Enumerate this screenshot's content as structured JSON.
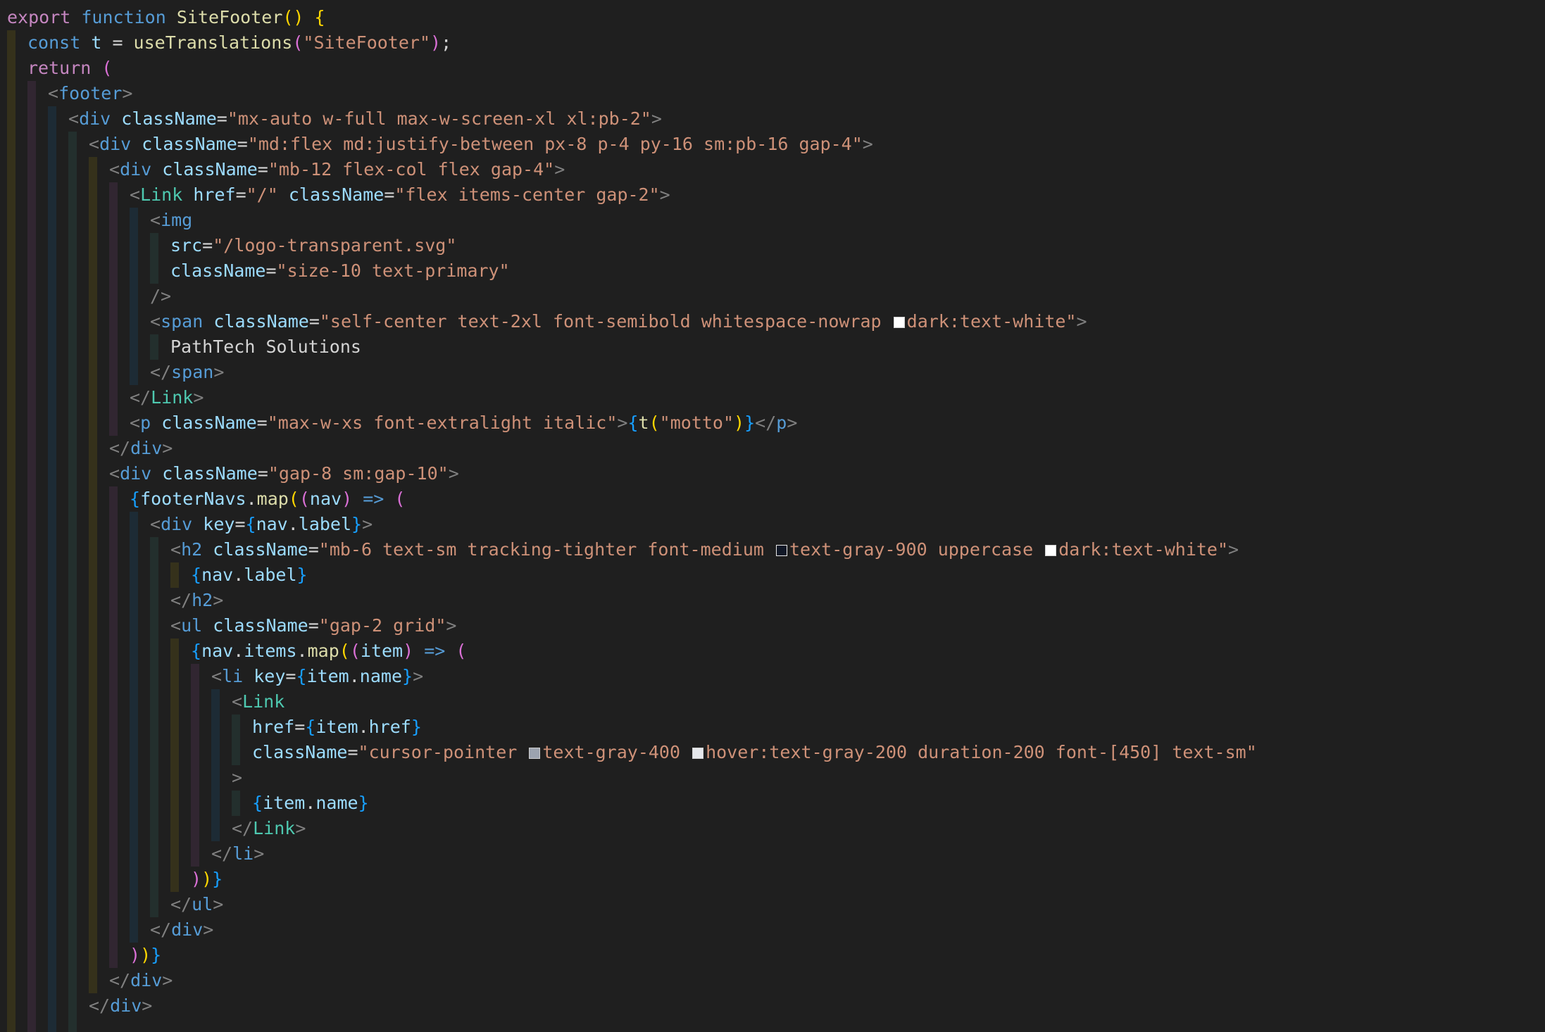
{
  "editor": {
    "colors": {
      "background": "#1f1f1f",
      "keyword": "#c586c0",
      "storage": "#569cd6",
      "function": "#dcdcaa",
      "variable": "#9cdcfe",
      "string": "#ce9178",
      "component_tag": "#4ec9b0",
      "html_tag": "#569cd6",
      "punctuation": "#808080",
      "text": "#d4d4d4",
      "bracket_level_1": "#ffd700",
      "bracket_level_2": "#da70d6",
      "bracket_level_3": "#179fff"
    },
    "lines": [
      {
        "indent": 0,
        "tokens": [
          [
            "kw",
            "export"
          ],
          [
            "tx",
            " "
          ],
          [
            "sk",
            "function"
          ],
          [
            "tx",
            " "
          ],
          [
            "fn",
            "SiteFooter"
          ],
          [
            "b1",
            "()"
          ],
          [
            "tx",
            " "
          ],
          [
            "b1",
            "{"
          ]
        ]
      },
      {
        "indent": 1,
        "tokens": [
          [
            "sk",
            "const"
          ],
          [
            "tx",
            " "
          ],
          [
            "vr",
            "t"
          ],
          [
            "op",
            " = "
          ],
          [
            "fn",
            "useTranslations"
          ],
          [
            "b2",
            "("
          ],
          [
            "st",
            "\"SiteFooter\""
          ],
          [
            "b2",
            ")"
          ],
          [
            "tx",
            ";"
          ]
        ]
      },
      {
        "indent": 1,
        "tokens": [
          [
            "kw",
            "return"
          ],
          [
            "tx",
            " "
          ],
          [
            "b2",
            "("
          ]
        ]
      },
      {
        "indent": 2,
        "tokens": [
          [
            "pu",
            "<"
          ],
          [
            "ht",
            "footer"
          ],
          [
            "pu",
            ">"
          ]
        ]
      },
      {
        "indent": 3,
        "tokens": [
          [
            "pu",
            "<"
          ],
          [
            "ht",
            "div"
          ],
          [
            "tx",
            " "
          ],
          [
            "at",
            "className"
          ],
          [
            "op",
            "="
          ],
          [
            "st",
            "\"mx-auto w-full max-w-screen-xl xl:pb-2\""
          ],
          [
            "pu",
            ">"
          ]
        ]
      },
      {
        "indent": 4,
        "tokens": [
          [
            "pu",
            "<"
          ],
          [
            "ht",
            "div"
          ],
          [
            "tx",
            " "
          ],
          [
            "at",
            "className"
          ],
          [
            "op",
            "="
          ],
          [
            "st",
            "\"md:flex md:justify-between px-8 p-4 py-16 sm:pb-16 gap-4\""
          ],
          [
            "pu",
            ">"
          ]
        ]
      },
      {
        "indent": 5,
        "tokens": [
          [
            "pu",
            "<"
          ],
          [
            "ht",
            "div"
          ],
          [
            "tx",
            " "
          ],
          [
            "at",
            "className"
          ],
          [
            "op",
            "="
          ],
          [
            "st",
            "\"mb-12 flex-col flex gap-4\""
          ],
          [
            "pu",
            ">"
          ]
        ]
      },
      {
        "indent": 6,
        "tokens": [
          [
            "pu",
            "<"
          ],
          [
            "tg",
            "Link"
          ],
          [
            "tx",
            " "
          ],
          [
            "at",
            "href"
          ],
          [
            "op",
            "="
          ],
          [
            "st",
            "\"/\""
          ],
          [
            "tx",
            " "
          ],
          [
            "at",
            "className"
          ],
          [
            "op",
            "="
          ],
          [
            "st",
            "\"flex items-center gap-2\""
          ],
          [
            "pu",
            ">"
          ]
        ]
      },
      {
        "indent": 7,
        "tokens": [
          [
            "pu",
            "<"
          ],
          [
            "ht",
            "img"
          ]
        ]
      },
      {
        "indent": 8,
        "tokens": [
          [
            "at",
            "src"
          ],
          [
            "op",
            "="
          ],
          [
            "st",
            "\"/logo-transparent.svg\""
          ]
        ]
      },
      {
        "indent": 8,
        "tokens": [
          [
            "at",
            "className"
          ],
          [
            "op",
            "="
          ],
          [
            "st",
            "\"size-10 text-primary\""
          ]
        ]
      },
      {
        "indent": 7,
        "tokens": [
          [
            "pu",
            "/>"
          ]
        ]
      },
      {
        "indent": 7,
        "tokens": [
          [
            "pu",
            "<"
          ],
          [
            "ht",
            "span"
          ],
          [
            "tx",
            " "
          ],
          [
            "at",
            "className"
          ],
          [
            "op",
            "="
          ],
          [
            "st",
            "\"self-center text-2xl font-semibold whitespace-nowrap "
          ],
          [
            "sw",
            "#ffffff"
          ],
          [
            "st",
            "dark:text-white\""
          ],
          [
            "pu",
            ">"
          ]
        ]
      },
      {
        "indent": 8,
        "tokens": [
          [
            "tx",
            "PathTech Solutions"
          ]
        ]
      },
      {
        "indent": 7,
        "tokens": [
          [
            "pu",
            "</"
          ],
          [
            "ht",
            "span"
          ],
          [
            "pu",
            ">"
          ]
        ]
      },
      {
        "indent": 6,
        "tokens": [
          [
            "pu",
            "</"
          ],
          [
            "tg",
            "Link"
          ],
          [
            "pu",
            ">"
          ]
        ]
      },
      {
        "indent": 6,
        "tokens": [
          [
            "pu",
            "<"
          ],
          [
            "ht",
            "p"
          ],
          [
            "tx",
            " "
          ],
          [
            "at",
            "className"
          ],
          [
            "op",
            "="
          ],
          [
            "st",
            "\"max-w-xs font-extralight italic\""
          ],
          [
            "pu",
            ">"
          ],
          [
            "b3",
            "{"
          ],
          [
            "fn",
            "t"
          ],
          [
            "b1",
            "("
          ],
          [
            "st",
            "\"motto\""
          ],
          [
            "b1",
            ")"
          ],
          [
            "b3",
            "}"
          ],
          [
            "pu",
            "</"
          ],
          [
            "ht",
            "p"
          ],
          [
            "pu",
            ">"
          ]
        ]
      },
      {
        "indent": 5,
        "tokens": [
          [
            "pu",
            "</"
          ],
          [
            "ht",
            "div"
          ],
          [
            "pu",
            ">"
          ]
        ]
      },
      {
        "indent": 5,
        "tokens": [
          [
            "pu",
            "<"
          ],
          [
            "ht",
            "div"
          ],
          [
            "tx",
            " "
          ],
          [
            "at",
            "className"
          ],
          [
            "op",
            "="
          ],
          [
            "st",
            "\"gap-8 sm:gap-10\""
          ],
          [
            "pu",
            ">"
          ]
        ]
      },
      {
        "indent": 6,
        "tokens": [
          [
            "b3",
            "{"
          ],
          [
            "vr",
            "footerNavs"
          ],
          [
            "tx",
            "."
          ],
          [
            "fn",
            "map"
          ],
          [
            "b1",
            "("
          ],
          [
            "b2",
            "("
          ],
          [
            "vr",
            "nav"
          ],
          [
            "b2",
            ")"
          ],
          [
            "tx",
            " "
          ],
          [
            "sk",
            "=>"
          ],
          [
            "tx",
            " "
          ],
          [
            "b2",
            "("
          ]
        ]
      },
      {
        "indent": 7,
        "tokens": [
          [
            "pu",
            "<"
          ],
          [
            "ht",
            "div"
          ],
          [
            "tx",
            " "
          ],
          [
            "at",
            "key"
          ],
          [
            "op",
            "="
          ],
          [
            "b3",
            "{"
          ],
          [
            "vr",
            "nav"
          ],
          [
            "tx",
            "."
          ],
          [
            "vr",
            "label"
          ],
          [
            "b3",
            "}"
          ],
          [
            "pu",
            ">"
          ]
        ]
      },
      {
        "indent": 8,
        "tokens": [
          [
            "pu",
            "<"
          ],
          [
            "ht",
            "h2"
          ],
          [
            "tx",
            " "
          ],
          [
            "at",
            "className"
          ],
          [
            "op",
            "="
          ],
          [
            "st",
            "\"mb-6 text-sm tracking-tighter font-medium "
          ],
          [
            "sw",
            "#111827"
          ],
          [
            "st",
            "text-gray-900 uppercase "
          ],
          [
            "sw",
            "#ffffff"
          ],
          [
            "st",
            "dark:text-white\""
          ],
          [
            "pu",
            ">"
          ]
        ]
      },
      {
        "indent": 9,
        "tokens": [
          [
            "b3",
            "{"
          ],
          [
            "vr",
            "nav"
          ],
          [
            "tx",
            "."
          ],
          [
            "vr",
            "label"
          ],
          [
            "b3",
            "}"
          ]
        ]
      },
      {
        "indent": 8,
        "tokens": [
          [
            "pu",
            "</"
          ],
          [
            "ht",
            "h2"
          ],
          [
            "pu",
            ">"
          ]
        ]
      },
      {
        "indent": 8,
        "tokens": [
          [
            "pu",
            "<"
          ],
          [
            "ht",
            "ul"
          ],
          [
            "tx",
            " "
          ],
          [
            "at",
            "className"
          ],
          [
            "op",
            "="
          ],
          [
            "st",
            "\"gap-2 grid\""
          ],
          [
            "pu",
            ">"
          ]
        ]
      },
      {
        "indent": 9,
        "tokens": [
          [
            "b3",
            "{"
          ],
          [
            "vr",
            "nav"
          ],
          [
            "tx",
            "."
          ],
          [
            "vr",
            "items"
          ],
          [
            "tx",
            "."
          ],
          [
            "fn",
            "map"
          ],
          [
            "b1",
            "("
          ],
          [
            "b2",
            "("
          ],
          [
            "vr",
            "item"
          ],
          [
            "b2",
            ")"
          ],
          [
            "tx",
            " "
          ],
          [
            "sk",
            "=>"
          ],
          [
            "tx",
            " "
          ],
          [
            "b2",
            "("
          ]
        ]
      },
      {
        "indent": 10,
        "tokens": [
          [
            "pu",
            "<"
          ],
          [
            "ht",
            "li"
          ],
          [
            "tx",
            " "
          ],
          [
            "at",
            "key"
          ],
          [
            "op",
            "="
          ],
          [
            "b3",
            "{"
          ],
          [
            "vr",
            "item"
          ],
          [
            "tx",
            "."
          ],
          [
            "vr",
            "name"
          ],
          [
            "b3",
            "}"
          ],
          [
            "pu",
            ">"
          ]
        ]
      },
      {
        "indent": 11,
        "tokens": [
          [
            "pu",
            "<"
          ],
          [
            "tg",
            "Link"
          ]
        ]
      },
      {
        "indent": 12,
        "tokens": [
          [
            "at",
            "href"
          ],
          [
            "op",
            "="
          ],
          [
            "b3",
            "{"
          ],
          [
            "vr",
            "item"
          ],
          [
            "tx",
            "."
          ],
          [
            "vr",
            "href"
          ],
          [
            "b3",
            "}"
          ]
        ]
      },
      {
        "indent": 12,
        "tokens": [
          [
            "at",
            "className"
          ],
          [
            "op",
            "="
          ],
          [
            "st",
            "\"cursor-pointer "
          ],
          [
            "sw",
            "#9ca3af"
          ],
          [
            "st",
            "text-gray-400 "
          ],
          [
            "sw",
            "#e5e7eb"
          ],
          [
            "st",
            "hover:text-gray-200 duration-200 font-[450] text-sm\""
          ]
        ]
      },
      {
        "indent": 11,
        "tokens": [
          [
            "pu",
            ">"
          ]
        ]
      },
      {
        "indent": 12,
        "tokens": [
          [
            "b3",
            "{"
          ],
          [
            "vr",
            "item"
          ],
          [
            "tx",
            "."
          ],
          [
            "vr",
            "name"
          ],
          [
            "b3",
            "}"
          ]
        ]
      },
      {
        "indent": 11,
        "tokens": [
          [
            "pu",
            "</"
          ],
          [
            "tg",
            "Link"
          ],
          [
            "pu",
            ">"
          ]
        ]
      },
      {
        "indent": 10,
        "tokens": [
          [
            "pu",
            "</"
          ],
          [
            "ht",
            "li"
          ],
          [
            "pu",
            ">"
          ]
        ]
      },
      {
        "indent": 9,
        "tokens": [
          [
            "b2",
            ")"
          ],
          [
            "b1",
            ")"
          ],
          [
            "b3",
            "}"
          ]
        ]
      },
      {
        "indent": 8,
        "tokens": [
          [
            "pu",
            "</"
          ],
          [
            "ht",
            "ul"
          ],
          [
            "pu",
            ">"
          ]
        ]
      },
      {
        "indent": 7,
        "tokens": [
          [
            "pu",
            "</"
          ],
          [
            "ht",
            "div"
          ],
          [
            "pu",
            ">"
          ]
        ]
      },
      {
        "indent": 6,
        "tokens": [
          [
            "b2",
            ")"
          ],
          [
            "b1",
            ")"
          ],
          [
            "b3",
            "}"
          ]
        ]
      },
      {
        "indent": 5,
        "tokens": [
          [
            "pu",
            "</"
          ],
          [
            "ht",
            "div"
          ],
          [
            "pu",
            ">"
          ]
        ]
      },
      {
        "indent": 4,
        "tokens": [
          [
            "pu",
            "</"
          ],
          [
            "ht",
            "div"
          ],
          [
            "pu",
            ">"
          ]
        ]
      },
      {
        "indent": 3,
        "tokens": []
      }
    ]
  }
}
